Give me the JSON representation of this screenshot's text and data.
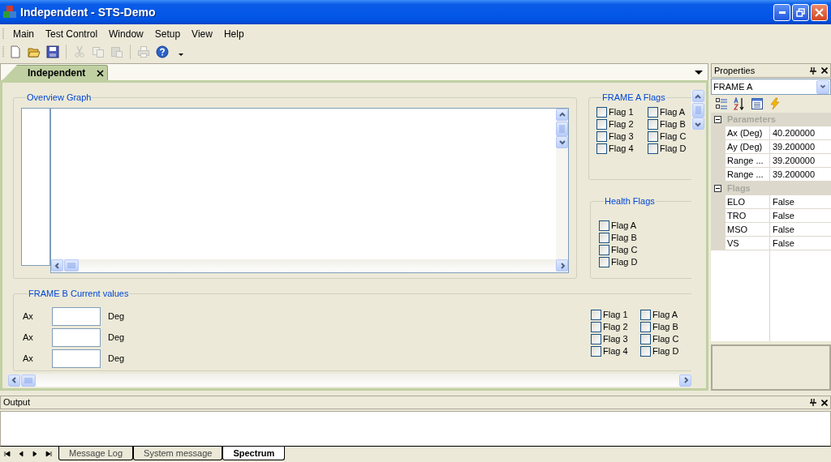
{
  "window": {
    "title": "Independent - STS-Demo"
  },
  "menu": [
    {
      "label": "Main"
    },
    {
      "label": "Test Control"
    },
    {
      "label": "Window"
    },
    {
      "label": "Setup"
    },
    {
      "label": "View"
    },
    {
      "label": "Help"
    }
  ],
  "toolbar": [
    {
      "kind": "new",
      "disabled": false
    },
    {
      "kind": "open",
      "disabled": false
    },
    {
      "kind": "save",
      "disabled": false
    },
    {
      "kind": "separator"
    },
    {
      "kind": "cut",
      "disabled": true
    },
    {
      "kind": "copy",
      "disabled": true
    },
    {
      "kind": "paste",
      "disabled": true
    },
    {
      "kind": "separator"
    },
    {
      "kind": "print",
      "disabled": true
    },
    {
      "kind": "help",
      "disabled": false
    },
    {
      "kind": "dropdown",
      "disabled": false
    }
  ],
  "document_tabs": [
    {
      "label": "Independent",
      "selected": true
    }
  ],
  "overview_graph": {
    "title": "Overview Graph"
  },
  "frame_a_flags": {
    "title": "FRAME A Flags",
    "flags": [
      {
        "label": "Flag 1",
        "checked": false
      },
      {
        "label": "Flag A",
        "checked": false
      },
      {
        "label": "Flag 2",
        "checked": false
      },
      {
        "label": "Flag B",
        "checked": false
      },
      {
        "label": "Flag 3",
        "checked": false
      },
      {
        "label": "Flag C",
        "checked": false
      },
      {
        "label": "Flag 4",
        "checked": false
      },
      {
        "label": "Flag D",
        "checked": false
      }
    ]
  },
  "health_flags": {
    "title": "Health Flags",
    "flags": [
      {
        "label": "Flag A",
        "checked": false
      },
      {
        "label": "Flag B",
        "checked": false
      },
      {
        "label": "Flag C",
        "checked": false
      },
      {
        "label": "Flag D",
        "checked": false
      }
    ]
  },
  "frame_b": {
    "title": "FRAME B Current values",
    "rows": [
      {
        "label": "Ax",
        "unit": "Deg"
      },
      {
        "label": "Ax",
        "unit": "Deg"
      },
      {
        "label": "Ax",
        "unit": "Deg"
      }
    ],
    "flags": [
      {
        "label": "Flag 1",
        "checked": false
      },
      {
        "label": "Flag A",
        "checked": false
      },
      {
        "label": "Flag 2",
        "checked": false
      },
      {
        "label": "Flag B",
        "checked": false
      },
      {
        "label": "Flag 3",
        "checked": false
      },
      {
        "label": "Flag C",
        "checked": false
      },
      {
        "label": "Flag 4",
        "checked": false
      },
      {
        "label": "Flag D",
        "checked": false
      }
    ]
  },
  "properties": {
    "title": "Properties",
    "object": "FRAME A",
    "categories": [
      {
        "name": "Parameters",
        "expanded": true,
        "rows": [
          {
            "name": "Ax (Deg)",
            "value": "40.200000"
          },
          {
            "name": "Ay (Deg)",
            "value": "39.200000"
          },
          {
            "name": "Range ...",
            "value": "39.200000"
          },
          {
            "name": "Range ...",
            "value": "39.200000"
          }
        ]
      },
      {
        "name": "Flags",
        "expanded": true,
        "rows": [
          {
            "name": "ELO",
            "value": "False"
          },
          {
            "name": "TRO",
            "value": "False"
          },
          {
            "name": "MSO",
            "value": "False"
          },
          {
            "name": "VS",
            "value": "False"
          }
        ]
      }
    ]
  },
  "output": {
    "title": "Output",
    "tabs": [
      {
        "label": "Message Log",
        "selected": false
      },
      {
        "label": "System message",
        "selected": false
      },
      {
        "label": "Spectrum",
        "selected": true
      }
    ]
  }
}
